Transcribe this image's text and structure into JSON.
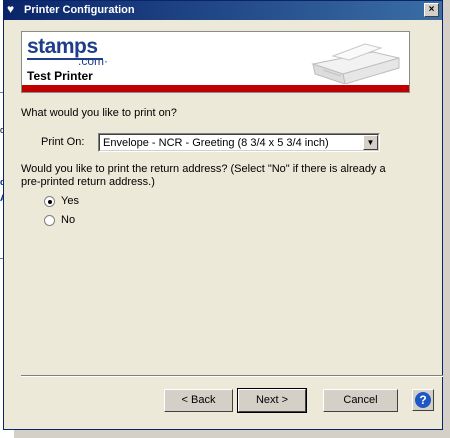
{
  "background_app": {
    "fragments": [
      "o",
      "d",
      "A"
    ]
  },
  "window": {
    "title": "Printer Configuration",
    "close_symbol": "×"
  },
  "banner": {
    "logo_main": "stamps",
    "logo_suffix": ".com·",
    "title": "Test Printer"
  },
  "form": {
    "question_print": "What would you like to print on?",
    "print_on_label": "Print On:",
    "print_on_value": "Envelope - NCR - Greeting (8 3/4 x 5 3/4 inch)",
    "question_return_line1": "Would you like to print the return address?  (Select \"No\" if there is already a",
    "question_return_line2": "pre-printed return address.)",
    "options": [
      {
        "label": "Yes",
        "selected": true
      },
      {
        "label": "No",
        "selected": false
      }
    ]
  },
  "buttons": {
    "back": "< Back",
    "next": "Next >",
    "cancel": "Cancel",
    "help": "?"
  },
  "colors": {
    "title_bar": "#0a246a",
    "logo": "#1f3d8a",
    "banner_stripe": "#c00000",
    "help": "#1f56c6"
  }
}
